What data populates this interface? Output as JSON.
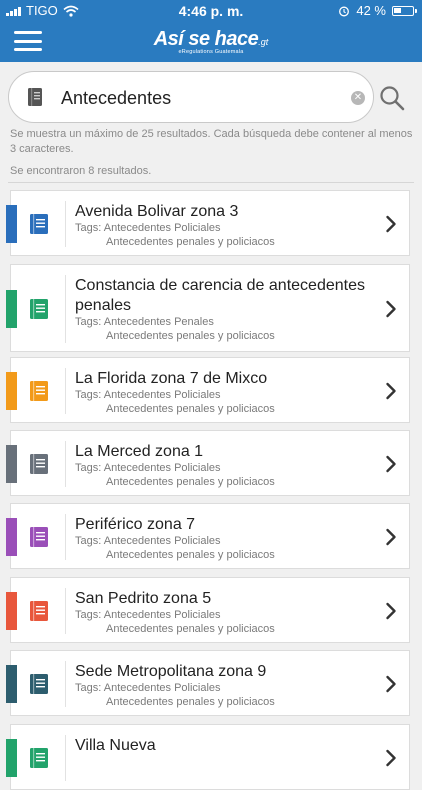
{
  "status_bar": {
    "carrier": "TIGO",
    "time": "4:46 p. m.",
    "battery_text": "42 %",
    "battery_level": 0.42
  },
  "header": {
    "logo_text": "Así se hace",
    "logo_suffix": ".gt",
    "logo_subtitle": "eRegulations Guatemala"
  },
  "search": {
    "value": "Antecedentes",
    "help_text": "Se muestra un máximo de 25 resultados.  Cada búsqueda debe contener al menos 3 caracteres.",
    "results_count": "Se encontraron 8 resultados."
  },
  "results": [
    {
      "title": "Avenida Bolivar zona 3",
      "tags_line1": "Tags: Antecedentes Policiales",
      "tags_line2": "Antecedentes penales y policiacos",
      "color": "#2a6ebb"
    },
    {
      "title": "Constancia de carencia de antecedentes penales",
      "tags_line1": "Tags: Antecedentes Penales",
      "tags_line2": "Antecedentes penales y policiacos",
      "color": "#22a36b"
    },
    {
      "title": "La Florida zona 7 de Mixco",
      "tags_line1": "Tags: Antecedentes Policiales",
      "tags_line2": "Antecedentes penales y policiacos",
      "color": "#f29a1a"
    },
    {
      "title": "La Merced zona 1",
      "tags_line1": "Tags: Antecedentes Policiales",
      "tags_line2": "Antecedentes penales y policiacos",
      "color": "#68707a"
    },
    {
      "title": "Periférico zona 7",
      "tags_line1": "Tags: Antecedentes Policiales",
      "tags_line2": "Antecedentes penales y policiacos",
      "color": "#9a4fb8"
    },
    {
      "title": "San Pedrito zona 5",
      "tags_line1": "Tags: Antecedentes Policiales",
      "tags_line2": "Antecedentes penales y policiacos",
      "color": "#e8573c"
    },
    {
      "title": "Sede Metropolitana zona 9",
      "tags_line1": "Tags: Antecedentes Policiales",
      "tags_line2": "Antecedentes penales y policiacos",
      "color": "#2d5d6e"
    },
    {
      "title": "Villa Nueva",
      "tags_line1": "",
      "tags_line2": "",
      "color": "#22a36b"
    }
  ]
}
